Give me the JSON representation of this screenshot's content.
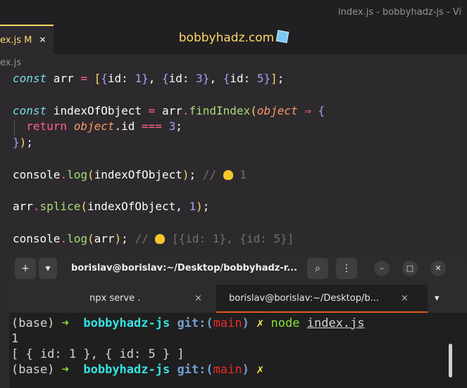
{
  "window": {
    "title": "index.js - bobbyhadz-js - Vi"
  },
  "editor": {
    "tab": {
      "label": "ex.js M",
      "close": "×"
    },
    "banner": "bobbyhadz.com",
    "breadcrumb": "ex.js",
    "lines": {
      "l1": {
        "kw": "const",
        "name": " arr ",
        "eq": "=",
        "sp": " ",
        "o1": "[",
        "o2": "{",
        "p1": "id: ",
        "n1": "1",
        "c2": "}",
        "cm1": ", ",
        "o3": "{",
        "p2": "id: ",
        "n2": "3",
        "c3": "}",
        "cm2": ", ",
        "o4": "{",
        "p3": "id: ",
        "n3": "5",
        "c4": "}",
        "c1": "]",
        "semi": ";"
      },
      "l3": {
        "kw": "const",
        "name": " indexOfObject ",
        "eq": "=",
        "sp": " ",
        "obj": "arr",
        "dot": ".",
        "fn": "findIndex",
        "open": "(",
        "param": "object",
        "arrow": " ⇒ ",
        "brace": "{"
      },
      "l4": {
        "indent": "  ",
        "kw": "return",
        "sp": " ",
        "param": "object",
        "prop": ".id ",
        "op": "===",
        "sp2": " ",
        "num": "3",
        "semi": ";"
      },
      "l5": {
        "brace": "}",
        "paren": ")",
        "semi": ";"
      },
      "l7": {
        "obj": "console",
        "dot": ".",
        "fn": "log",
        "open": "(",
        "arg": "indexOfObject",
        "close": ")",
        "semi": ";",
        "comment": " // ",
        "result": " 1"
      },
      "l9": {
        "obj": "arr",
        "dot": ".",
        "fn": "splice",
        "open": "(",
        "arg": "indexOfObject, ",
        "num": "1",
        "close": ")",
        "semi": ";"
      },
      "l11": {
        "obj": "console",
        "dot": ".",
        "fn": "log",
        "open": "(",
        "arg": "arr",
        "close": ")",
        "semi": ";",
        "comment": " // ",
        "result": " [{id: 1}, {id: 5}]"
      }
    }
  },
  "terminal": {
    "title": "borislav@borislav:~/Desktop/bobbyhadz-r...",
    "buttons": {
      "new_tab": "+",
      "dropdown": "▾",
      "search": "⌕",
      "menu": "⋮",
      "minimize": "–",
      "maximize": "□",
      "close": "✕"
    },
    "tabs": [
      {
        "label": "npx serve .",
        "close": "×"
      },
      {
        "label": "borislav@borislav:~/Desktop/b...",
        "close": "×"
      }
    ],
    "tabs_menu": "▾",
    "lines": [
      {
        "base": "(base) ",
        "arrow": "➜",
        "dir": "  bobbyhadz-js ",
        "git": "git:(",
        "branch": "main",
        "gitclose": ")",
        "x": " ✗ ",
        "cmd": "node ",
        "arg": "index.js"
      },
      {
        "text": "1"
      },
      {
        "text": "[ { id: 1 }, { id: 5 } ]"
      },
      {
        "base": "(base) ",
        "arrow": "➜",
        "dir": "  bobbyhadz-js ",
        "git": "git:(",
        "branch": "main",
        "gitclose": ")",
        "x": " ✗ "
      }
    ]
  },
  "colors": {
    "accent": "#ffd866",
    "terminal_bg": "#1f1f1f",
    "tab_active_border": "#e95420"
  }
}
